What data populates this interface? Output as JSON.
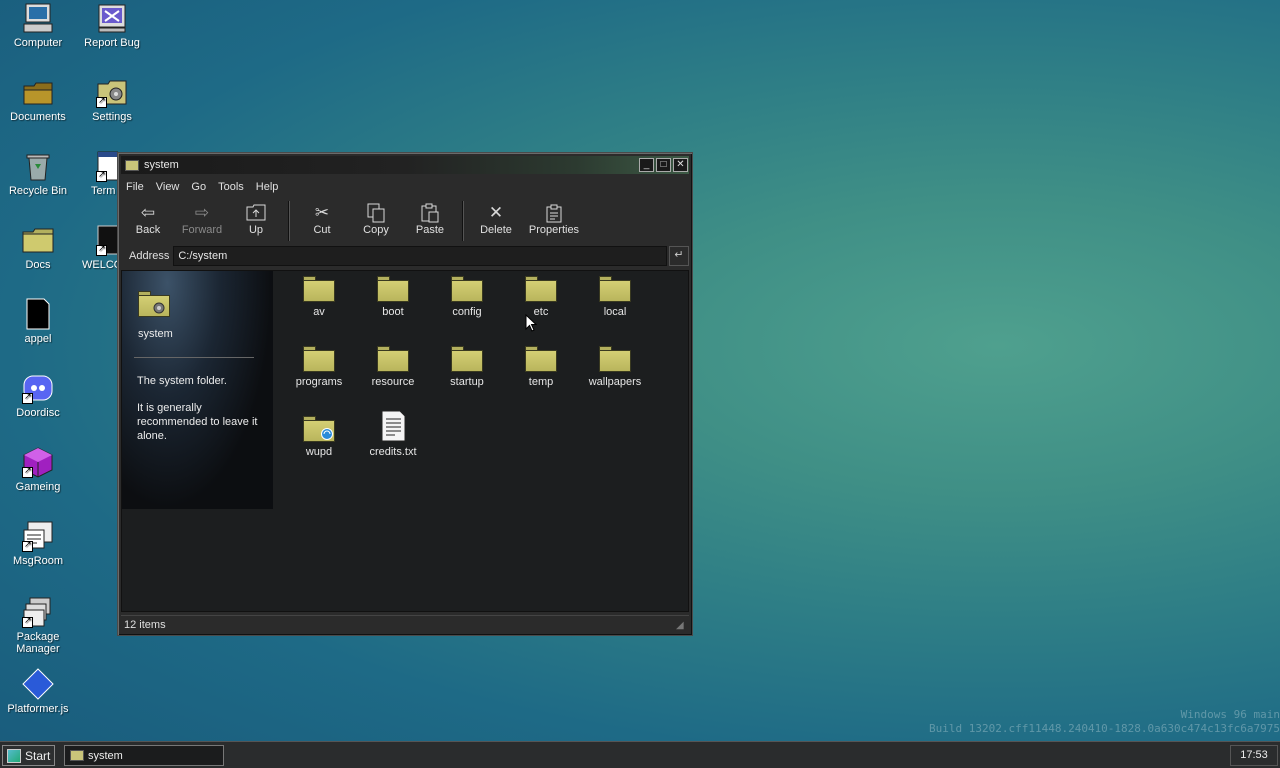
{
  "desktop": {
    "icons": [
      {
        "label": "Computer"
      },
      {
        "label": "Report Bug"
      },
      {
        "label": "Documents"
      },
      {
        "label": "Settings"
      },
      {
        "label": "Recycle Bin"
      },
      {
        "label": "Term"
      },
      {
        "label": "Docs"
      },
      {
        "label": "WELCO"
      },
      {
        "label": "appel"
      },
      {
        "label": "Doordisc"
      },
      {
        "label": "Gameing"
      },
      {
        "label": "MsgRoom"
      },
      {
        "label": "Package Manager"
      },
      {
        "label": "Platformer.js"
      }
    ]
  },
  "window": {
    "title": "system",
    "menu": [
      "File",
      "View",
      "Go",
      "Tools",
      "Help"
    ],
    "toolbar": {
      "back": "Back",
      "forward": "Forward",
      "up": "Up",
      "cut": "Cut",
      "copy": "Copy",
      "paste": "Paste",
      "delete": "Delete",
      "properties": "Properties"
    },
    "address_label": "Address",
    "address_value": "C:/system",
    "side_panel": {
      "name": "system",
      "desc1": "The system folder.",
      "desc2": "It is generally recommended to leave it alone."
    },
    "files": [
      {
        "name": "av",
        "type": "folder"
      },
      {
        "name": "boot",
        "type": "folder"
      },
      {
        "name": "config",
        "type": "folder"
      },
      {
        "name": "etc",
        "type": "folder"
      },
      {
        "name": "local",
        "type": "folder"
      },
      {
        "name": "programs",
        "type": "folder"
      },
      {
        "name": "resource",
        "type": "folder"
      },
      {
        "name": "startup",
        "type": "folder"
      },
      {
        "name": "temp",
        "type": "folder"
      },
      {
        "name": "wallpapers",
        "type": "folder"
      },
      {
        "name": "wupd",
        "type": "folder-special"
      },
      {
        "name": "credits.txt",
        "type": "text-file"
      }
    ],
    "status": "12 items"
  },
  "watermark": {
    "line1": "Windows 96 main",
    "line2": "Build 13202.cff11448.240410-1828.0a630c474c13fc6a7975"
  },
  "taskbar": {
    "start_label": "Start",
    "task_label": "system",
    "clock": "17:53"
  }
}
